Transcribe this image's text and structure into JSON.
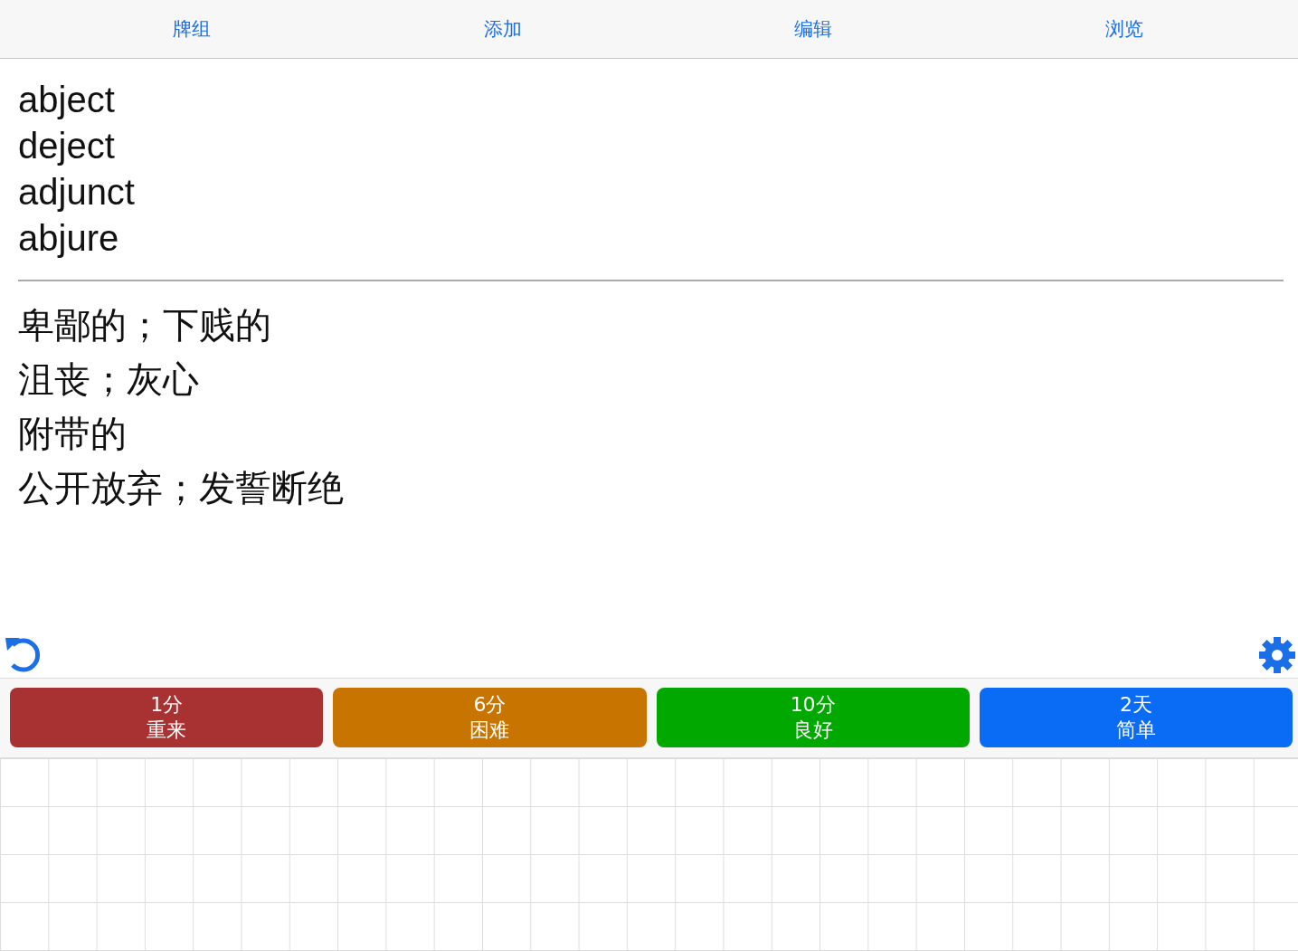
{
  "tabs": [
    {
      "label": "牌组"
    },
    {
      "label": "添加"
    },
    {
      "label": "编辑"
    },
    {
      "label": "浏览"
    }
  ],
  "question_lines": [
    "abject",
    "deject",
    "adjunct",
    "abjure"
  ],
  "answer_lines": [
    "卑鄙的；下贱的",
    "沮丧；灰心",
    "附带的",
    "公开放弃；发誓断绝"
  ],
  "answer_buttons": [
    {
      "interval": "1分",
      "label": "重来",
      "color": "#a83232"
    },
    {
      "interval": "6分",
      "label": "困难",
      "color": "#c87400"
    },
    {
      "interval": "10分",
      "label": "良好",
      "color": "#00a800"
    },
    {
      "interval": "2天",
      "label": "简单",
      "color": "#0a6cf5"
    }
  ]
}
